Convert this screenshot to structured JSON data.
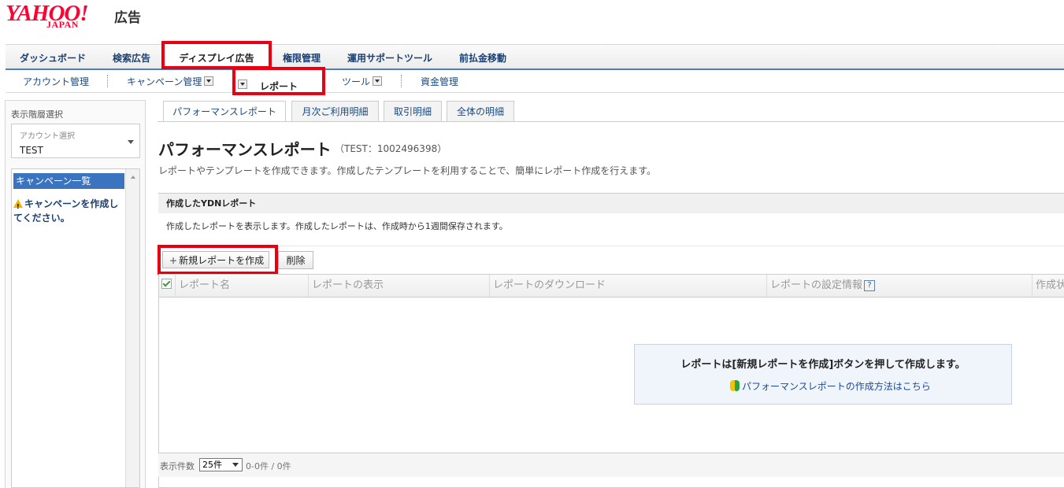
{
  "logo": {
    "brand": "YAHOO!",
    "sub": "JAPAN",
    "service": "広告"
  },
  "main_nav": {
    "items": [
      "ダッシュボード",
      "検索広告",
      "ディスプレイ広告",
      "権限管理",
      "運用サポートツール",
      "前払金移動"
    ],
    "active_index": 2
  },
  "sub_nav": {
    "items": [
      "アカウント管理",
      "キャンペーン管理",
      "レポート",
      "ツール",
      "資金管理"
    ],
    "active_index": 2
  },
  "left_panel": {
    "title": "表示階層選択",
    "account_select_label": "アカウント選択",
    "account_select_value": "TEST",
    "campaign_list_header": "キャンペーン一覧",
    "campaign_warning": "キャンペーンを作成してください。"
  },
  "tabs": [
    "パフォーマンスレポート",
    "月次ご利用明細",
    "取引明細",
    "全体の明細"
  ],
  "page": {
    "title": "パフォーマンスレポート",
    "subtitle": "（TEST：1002496398）",
    "description": "レポートやテンプレートを作成できます。作成したテンプレートを利用することで、簡単にレポート作成を行えます。"
  },
  "section": {
    "heading": "作成したYDNレポート",
    "description": "作成したレポートを表示します。作成したレポートは、作成時から1週間保存されます。"
  },
  "toolbar": {
    "new_label": "新規レポートを作成",
    "delete_label": "削除"
  },
  "table": {
    "columns": [
      "レポート名",
      "レポートの表示",
      "レポートのダウンロード",
      "レポートの設定情報",
      "作成状況"
    ],
    "help_mark": "?"
  },
  "empty_state": {
    "message": "レポートは[新規レポートを作成]ボタンを押して作成します。",
    "link": "パフォーマンスレポートの作成方法はこちら"
  },
  "footer": {
    "count_label": "表示件数",
    "page_size": "25件",
    "range": "0-0件 / 0件"
  },
  "colors": {
    "brand_red": "#ff0033",
    "highlight_red": "#e60012",
    "nav_text": "#1a3f73",
    "accent_blue": "#3a73c0"
  }
}
